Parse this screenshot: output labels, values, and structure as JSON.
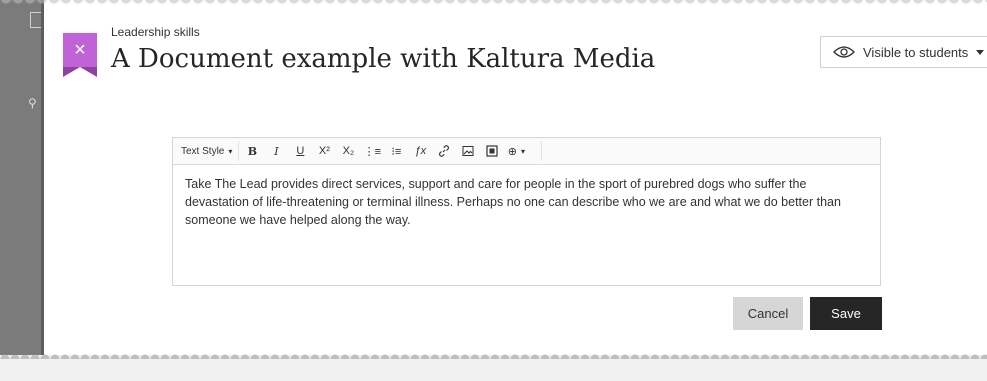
{
  "header": {
    "breadcrumb": "Leadership skills",
    "title": "A Document example with Kaltura Media",
    "close_icon": "×"
  },
  "visibility": {
    "label": "Visible to students",
    "icon": "eye-icon"
  },
  "settings": {
    "icon": "gear-icon"
  },
  "editor": {
    "toolbar": {
      "text_style_label": "Text Style",
      "buttons": [
        {
          "name": "bold",
          "glyph": "B"
        },
        {
          "name": "italic",
          "glyph": "I"
        },
        {
          "name": "underline",
          "glyph": "U"
        },
        {
          "name": "superscript",
          "glyph": "X²"
        },
        {
          "name": "subscript",
          "glyph": "X₂"
        },
        {
          "name": "ordered-list",
          "glyph": "⋮≡"
        },
        {
          "name": "bullet-list",
          "glyph": "⁝≡"
        },
        {
          "name": "formula",
          "glyph": "ƒx"
        },
        {
          "name": "link",
          "glyph": "🔗"
        },
        {
          "name": "image",
          "glyph": "🖼"
        },
        {
          "name": "media",
          "glyph": "▣"
        },
        {
          "name": "insert",
          "glyph": "⊕"
        }
      ]
    },
    "content": "Take The Lead provides direct services, support and care for people in the sport of purebred dogs who suffer the devastation of life-threatening or terminal illness. Perhaps no one can describe who we are and what we do better than someone we have helped along the way."
  },
  "actions": {
    "cancel_label": "Cancel",
    "save_label": "Save"
  },
  "colors": {
    "accent": "#c063d6",
    "save_bg": "#262626",
    "cancel_bg": "#d6d6d6"
  }
}
